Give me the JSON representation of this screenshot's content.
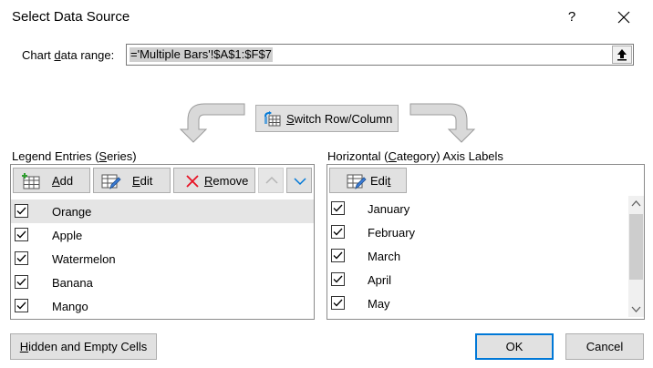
{
  "dialog": {
    "title": "Select Data Source",
    "help": "?"
  },
  "range": {
    "label_pre": "Chart ",
    "label_key": "d",
    "label_post": "ata range:",
    "value": "='Multiple Bars'!$A$1:$F$7"
  },
  "switch": {
    "label_key": "S",
    "label_rest": "witch Row/Column"
  },
  "legend": {
    "label_pre": "Legend Entries (",
    "label_key": "S",
    "label_post": "eries)",
    "add_key": "A",
    "add_rest": "dd",
    "edit_key": "E",
    "edit_rest": "dit",
    "remove_key": "R",
    "remove_rest": "emove",
    "series": [
      {
        "name": "Orange",
        "checked": true,
        "selected": true
      },
      {
        "name": "Apple",
        "checked": true,
        "selected": false
      },
      {
        "name": "Watermelon",
        "checked": true,
        "selected": false
      },
      {
        "name": "Banana",
        "checked": true,
        "selected": false
      },
      {
        "name": "Mango",
        "checked": true,
        "selected": false
      }
    ]
  },
  "axis": {
    "label_pre": "Horizontal (",
    "label_key": "C",
    "label_post": "ategory) Axis Labels",
    "edit_pre": "Edi",
    "edit_key": "t",
    "labels": [
      {
        "name": "January",
        "checked": true
      },
      {
        "name": "February",
        "checked": true
      },
      {
        "name": "March",
        "checked": true
      },
      {
        "name": "April",
        "checked": true
      },
      {
        "name": "May",
        "checked": true
      }
    ]
  },
  "footer": {
    "hidden_key": "H",
    "hidden_rest": "idden and Empty Cells",
    "ok": "OK",
    "cancel": "Cancel"
  },
  "colors": {
    "accent": "#0078d7",
    "remove_icon": "#e81123",
    "down_arrow": "#0078d7"
  }
}
